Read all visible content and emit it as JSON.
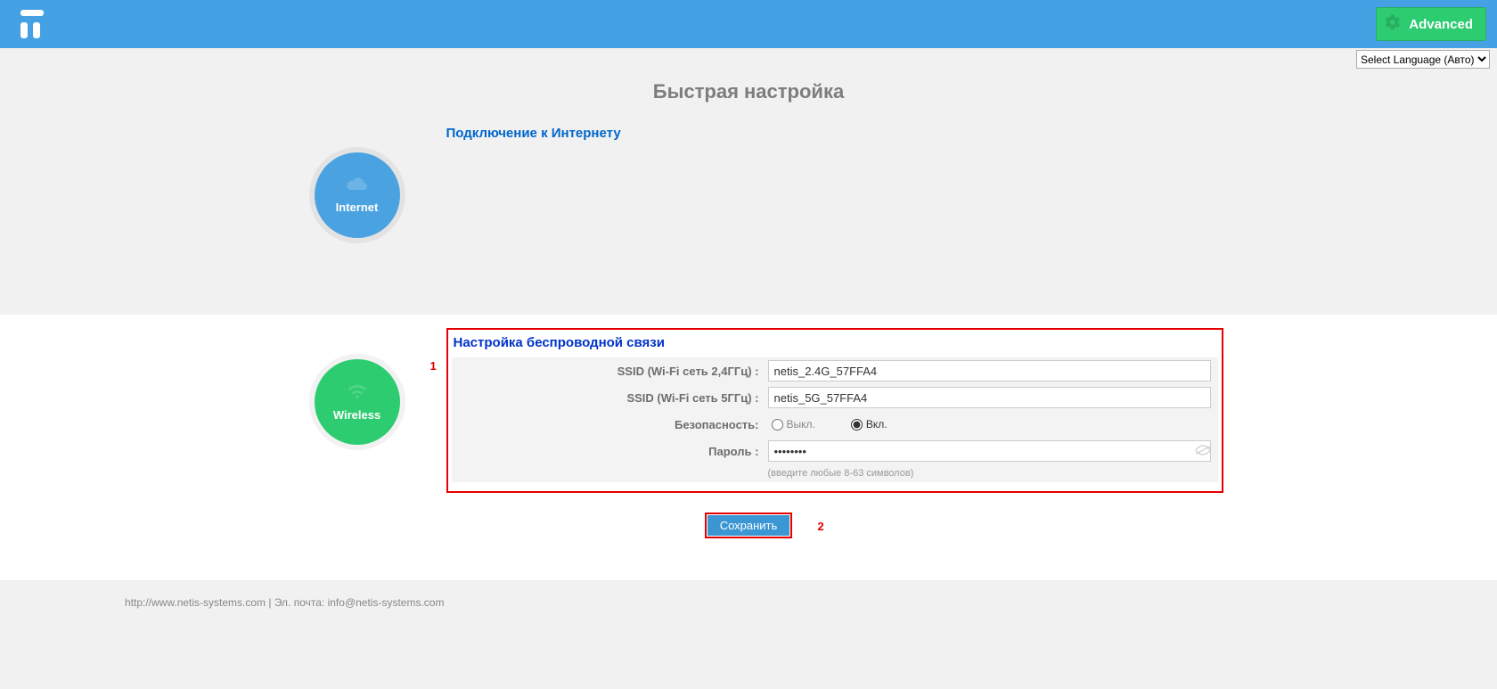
{
  "header": {
    "advanced_label": "Advanced"
  },
  "language": {
    "selected": "Select Language (Авто)"
  },
  "page_title": "Быстрая настройка",
  "internet": {
    "section_title": "Подключение к Интернету",
    "circle_label": "Internet"
  },
  "wireless": {
    "circle_label": "Wireless",
    "section_title": "Настройка беспроводной связи",
    "ssid24_label": "SSID (Wi-Fi сеть 2,4ГГц) :",
    "ssid24_value": "netis_2.4G_57FFA4",
    "ssid5_label": "SSID (Wi-Fi сеть 5ГГц) :",
    "ssid5_value": "netis_5G_57FFA4",
    "security_label": "Безопасность:",
    "security_off": "Выкл.",
    "security_on": "Вкл.",
    "password_label": "Пароль :",
    "password_value": "••••••••",
    "password_hint": "(введите любые 8-63 символов)"
  },
  "annotations": {
    "one": "1",
    "two": "2"
  },
  "actions": {
    "save_label": "Сохранить"
  },
  "footer": {
    "text_prefix": "http://www.netis-systems.com | Эл. почта: ",
    "email": "info@netis-systems.com"
  }
}
